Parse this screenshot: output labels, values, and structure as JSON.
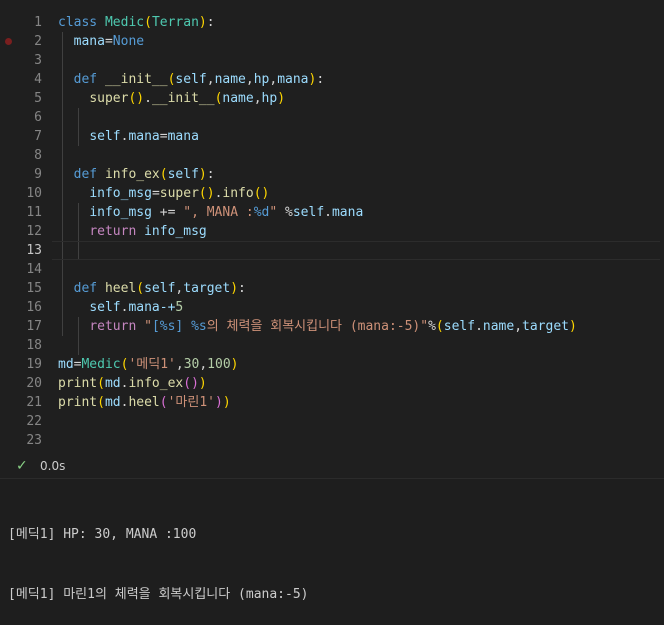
{
  "editor": {
    "line_numbers": [
      "1",
      "2",
      "3",
      "4",
      "5",
      "6",
      "7",
      "8",
      "9",
      "10",
      "11",
      "12",
      "13",
      "14",
      "15",
      "16",
      "17",
      "18",
      "19",
      "20",
      "21",
      "22",
      "23"
    ],
    "current_line": "13",
    "breakpoint_line": "2",
    "tokens": {
      "class_kw": "class",
      "class_name": "Medic",
      "base_class": "Terran",
      "mana_attr": "mana",
      "none_kw": "None",
      "def_kw": "def",
      "init_fn": "__init__",
      "self": "self",
      "p_name": "name",
      "p_hp": "hp",
      "p_mana": "mana",
      "super_fn": "super",
      "info_ex_fn": "info_ex",
      "info_fn": "info",
      "info_msg": "info_msg",
      "info_str": "\", MANA :",
      "info_fmt": "%d",
      "info_str_end": "\"",
      "return_kw": "return",
      "heel_fn": "heel",
      "p_target": "target",
      "mana_expr": "mana-+",
      "five": "5",
      "heel_str_open": "\"",
      "heel_fmt1": "[%s]",
      "heel_fmt2": "%s",
      "heel_str_mid": "의 체력을 회복시킵니다 (mana:-5)\"",
      "md_var": "md",
      "medic_call_str": "'메딕1'",
      "n30": "30",
      "n100": "100",
      "print_fn": "print",
      "marine_str": "'마린1'"
    }
  },
  "status": {
    "check_icon": "check-icon",
    "time": "0.0s"
  },
  "output": {
    "line1": "[메딕1] HP: 30, MANA :100",
    "line2": "[메딕1] 마린1의 체력을 회복시킵니다 (mana:-5)"
  },
  "colors": {
    "keyword": "#569cd6",
    "function": "#dcdcaa",
    "class": "#4ec9b0",
    "variable": "#9cdcfe",
    "string": "#ce9178",
    "number": "#b5cea8",
    "control": "#c586c0",
    "success": "#89d185"
  }
}
